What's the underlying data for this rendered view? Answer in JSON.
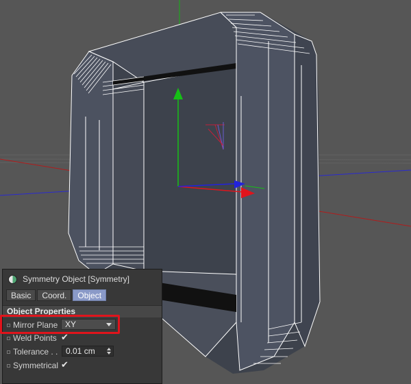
{
  "panel": {
    "title": "Symmetry Object [Symmetry]",
    "icon": "symmetry-object-icon",
    "tabs": [
      {
        "label": "Basic",
        "active": false
      },
      {
        "label": "Coord.",
        "active": false
      },
      {
        "label": "Object",
        "active": true
      }
    ],
    "section_title": "Object Properties",
    "properties": {
      "mirror_plane": {
        "label": "Mirror Plane",
        "value": "XY"
      },
      "weld_points": {
        "label": "Weld Points",
        "checked": true,
        "check_glyph": "✔"
      },
      "tolerance": {
        "label": "Tolerance . .",
        "value": "0.01 cm"
      },
      "symmetrical": {
        "label": "Symmetrical",
        "checked": true,
        "check_glyph": "✔"
      }
    }
  },
  "colors": {
    "background": "#565656",
    "mesh_fill": "#444a55",
    "wireframe": "#ffffff",
    "x_axis": "#e0141c",
    "y_axis": "#16c016",
    "z_axis": "#2222dd",
    "active_tab": "#8a9ac8",
    "highlight": "#e0141c"
  }
}
